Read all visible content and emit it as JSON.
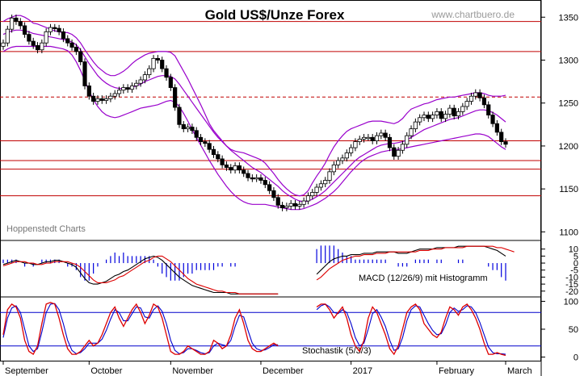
{
  "header": {
    "title": "Gold US$/Unze Forex",
    "watermark": "www.chartbuero.de"
  },
  "chart_data": [
    {
      "type": "candlestick",
      "panel": "price",
      "title": "Gold US$/Unze Forex",
      "source_label": "Hoppenstedt Charts",
      "y_ticks": [
        1100,
        1150,
        1200,
        1250,
        1300,
        1350
      ],
      "ylim": [
        1090,
        1370
      ],
      "x_months": [
        "September",
        "October",
        "November",
        "December",
        "2017",
        "February",
        "March"
      ],
      "horizontal_lines": [
        1345,
        1310,
        1257,
        1206,
        1183,
        1173,
        1142
      ],
      "dashed_lines": [
        1257
      ],
      "closes": [
        1320,
        1336,
        1349,
        1345,
        1340,
        1330,
        1322,
        1317,
        1312,
        1320,
        1333,
        1338,
        1337,
        1333,
        1325,
        1320,
        1315,
        1310,
        1298,
        1270,
        1258,
        1252,
        1255,
        1253,
        1255,
        1258,
        1261,
        1265,
        1268,
        1266,
        1270,
        1273,
        1277,
        1283,
        1290,
        1302,
        1300,
        1290,
        1280,
        1268,
        1245,
        1225,
        1220,
        1222,
        1218,
        1210,
        1205,
        1203,
        1196,
        1190,
        1185,
        1178,
        1175,
        1172,
        1177,
        1172,
        1168,
        1163,
        1162,
        1163,
        1160,
        1155,
        1148,
        1140,
        1131,
        1128,
        1130,
        1133,
        1130,
        1132,
        1136,
        1142,
        1146,
        1152,
        1156,
        1160,
        1170,
        1178,
        1183,
        1186,
        1192,
        1198,
        1205,
        1208,
        1210,
        1210,
        1206,
        1212,
        1215,
        1210,
        1198,
        1188,
        1195,
        1202,
        1212,
        1220,
        1228,
        1233,
        1236,
        1232,
        1236,
        1240,
        1232,
        1237,
        1244,
        1235,
        1240,
        1246,
        1252,
        1258,
        1262,
        1256,
        1248,
        1236,
        1226,
        1216,
        1205,
        1202
      ],
      "bollinger_upper": [
        1345,
        1348,
        1350,
        1352,
        1352,
        1350,
        1347,
        1343,
        1342,
        1340,
        1338,
        1336,
        1334,
        1333,
        1332,
        1332,
        1330,
        1326,
        1320,
        1312,
        1305,
        1298,
        1292,
        1288,
        1284,
        1282,
        1282,
        1284,
        1287,
        1291,
        1296,
        1300,
        1303,
        1306,
        1308,
        1309,
        1310,
        1310,
        1310,
        1309,
        1305,
        1296,
        1287,
        1278,
        1268,
        1258,
        1248,
        1237,
        1226,
        1218,
        1212,
        1206,
        1200,
        1196,
        1194,
        1193,
        1192,
        1190,
        1188,
        1186,
        1184,
        1180,
        1174,
        1168,
        1161,
        1155,
        1150,
        1146,
        1143,
        1142,
        1143,
        1148,
        1157,
        1165,
        1172,
        1180,
        1190,
        1199,
        1206,
        1212,
        1217,
        1220,
        1222,
        1224,
        1226,
        1228,
        1229,
        1229,
        1229,
        1228,
        1227,
        1226,
        1228,
        1232,
        1238,
        1243,
        1245,
        1247,
        1249,
        1250,
        1252,
        1254,
        1255,
        1256,
        1257,
        1257,
        1258,
        1259,
        1260,
        1261,
        1262,
        1262,
        1261,
        1259,
        1258,
        1258,
        1258,
        1259
      ],
      "bollinger_middle": [
        1330,
        1332,
        1334,
        1335,
        1335,
        1334,
        1333,
        1331,
        1330,
        1329,
        1328,
        1327,
        1326,
        1325,
        1324,
        1323,
        1321,
        1318,
        1312,
        1304,
        1296,
        1289,
        1282,
        1277,
        1273,
        1270,
        1268,
        1267,
        1267,
        1267,
        1268,
        1270,
        1272,
        1275,
        1277,
        1279,
        1281,
        1282,
        1282,
        1281,
        1278,
        1272,
        1265,
        1258,
        1251,
        1244,
        1237,
        1230,
        1223,
        1216,
        1210,
        1205,
        1200,
        1195,
        1191,
        1187,
        1183,
        1179,
        1175,
        1172,
        1169,
        1165,
        1161,
        1157,
        1153,
        1148,
        1144,
        1141,
        1138,
        1136,
        1135,
        1136,
        1138,
        1141,
        1144,
        1148,
        1153,
        1158,
        1163,
        1168,
        1173,
        1178,
        1183,
        1187,
        1190,
        1193,
        1196,
        1199,
        1201,
        1202,
        1203,
        1203,
        1204,
        1205,
        1207,
        1210,
        1213,
        1216,
        1219,
        1221,
        1223,
        1225,
        1227,
        1229,
        1231,
        1232,
        1233,
        1235,
        1237,
        1239,
        1241,
        1242,
        1242,
        1241,
        1239,
        1236,
        1232,
        1228
      ],
      "bollinger_lower": [
        1310,
        1313,
        1315,
        1316,
        1316,
        1316,
        1316,
        1316,
        1316,
        1316,
        1316,
        1316,
        1315,
        1314,
        1313,
        1311,
        1306,
        1298,
        1288,
        1276,
        1264,
        1254,
        1246,
        1240,
        1236,
        1234,
        1233,
        1234,
        1236,
        1238,
        1240,
        1242,
        1244,
        1245,
        1246,
        1247,
        1248,
        1250,
        1252,
        1253,
        1251,
        1246,
        1238,
        1229,
        1219,
        1210,
        1201,
        1192,
        1183,
        1175,
        1167,
        1160,
        1153,
        1147,
        1142,
        1138,
        1135,
        1133,
        1132,
        1132,
        1132,
        1132,
        1131,
        1130,
        1129,
        1128,
        1127,
        1126,
        1126,
        1126,
        1127,
        1129,
        1131,
        1133,
        1136,
        1139,
        1143,
        1147,
        1152,
        1158,
        1164,
        1170,
        1175,
        1180,
        1184,
        1187,
        1189,
        1191,
        1193,
        1194,
        1195,
        1196,
        1196,
        1197,
        1198,
        1199,
        1200,
        1201,
        1202,
        1203,
        1204,
        1205,
        1206,
        1207,
        1208,
        1209,
        1210,
        1211,
        1212,
        1213,
        1214,
        1214,
        1213,
        1211,
        1207,
        1203,
        1199,
        1196
      ]
    },
    {
      "type": "line",
      "panel": "macd",
      "label": "MACD (12/26/9) mit Histogramm",
      "y_ticks": [
        10,
        5,
        0,
        -5,
        -10,
        -15,
        -20
      ],
      "ylim": [
        -23,
        15
      ],
      "macd": [
        -1,
        0,
        1,
        2,
        1,
        0,
        0,
        -1,
        -1,
        0,
        1,
        1,
        2,
        2,
        1,
        0,
        -1,
        -3,
        -7,
        -11,
        -14,
        -15,
        -15,
        -14,
        -13,
        -11,
        -9,
        -8,
        -6,
        -5,
        -3,
        -1,
        1,
        3,
        4,
        5,
        4,
        2,
        -1,
        -4,
        -7,
        -10,
        -12,
        -14,
        -16,
        -17,
        -18,
        -19,
        -20,
        -21,
        -21,
        -21,
        -21,
        -22,
        -22,
        -22,
        -22,
        -22,
        -22,
        -22,
        -22,
        -22,
        -22,
        -22,
        -22,
        null,
        null,
        null,
        null,
        null,
        null,
        null,
        null,
        -8,
        -5,
        -2,
        1,
        3,
        4,
        5,
        5,
        6,
        6,
        6,
        7,
        7,
        7,
        8,
        8,
        8,
        8,
        8,
        7,
        7,
        7,
        8,
        9,
        10,
        10,
        10,
        10,
        11,
        11,
        11,
        11,
        11,
        12,
        12,
        12,
        12,
        12,
        12,
        12,
        11,
        10,
        9,
        7,
        5
      ],
      "signal": [
        -2,
        -1,
        0,
        1,
        1,
        1,
        0,
        0,
        -1,
        -1,
        0,
        0,
        1,
        1,
        1,
        1,
        0,
        -1,
        -3,
        -6,
        -9,
        -12,
        -14,
        -14,
        -14,
        -13,
        -12,
        -10,
        -9,
        -7,
        -5,
        -3,
        -1,
        1,
        2,
        4,
        5,
        5,
        3,
        1,
        -2,
        -5,
        -8,
        -11,
        -13,
        -15,
        -16,
        -17,
        -18,
        -19,
        -20,
        -20,
        -21,
        -21,
        -21,
        -22,
        -22,
        -22,
        -22,
        -22,
        -22,
        -22,
        -22,
        -22,
        -22,
        null,
        null,
        null,
        null,
        null,
        null,
        null,
        null,
        -12,
        -10,
        -7,
        -4,
        -2,
        0,
        2,
        3,
        4,
        5,
        5,
        6,
        6,
        6,
        7,
        7,
        7,
        8,
        8,
        8,
        8,
        8,
        8,
        8,
        9,
        9,
        9,
        10,
        10,
        10,
        11,
        11,
        11,
        11,
        11,
        12,
        12,
        12,
        12,
        12,
        12,
        12,
        11,
        11,
        10,
        9,
        8
      ]
    },
    {
      "type": "line",
      "panel": "stochastic",
      "label": "Stochastik (5/3/3)",
      "y_ticks": [
        100,
        50,
        0
      ],
      "ylim": [
        -5,
        105
      ],
      "reference_lines": [
        80,
        20
      ],
      "k": [
        40,
        85,
        95,
        90,
        70,
        30,
        10,
        5,
        20,
        60,
        95,
        98,
        95,
        70,
        40,
        15,
        5,
        5,
        10,
        20,
        30,
        20,
        25,
        40,
        60,
        80,
        90,
        70,
        55,
        70,
        85,
        95,
        80,
        60,
        75,
        95,
        90,
        70,
        40,
        10,
        5,
        5,
        10,
        20,
        15,
        10,
        5,
        5,
        10,
        30,
        25,
        15,
        20,
        40,
        70,
        85,
        60,
        30,
        15,
        10,
        10,
        15,
        20,
        25,
        20,
        null,
        null,
        null,
        null,
        null,
        null,
        null,
        null,
        90,
        95,
        95,
        85,
        70,
        80,
        90,
        70,
        40,
        20,
        10,
        30,
        70,
        90,
        80,
        60,
        40,
        15,
        5,
        20,
        50,
        80,
        90,
        95,
        85,
        60,
        50,
        40,
        35,
        45,
        70,
        90,
        85,
        75,
        90,
        95,
        85,
        70,
        50,
        25,
        5,
        5,
        8,
        5,
        3
      ],
      "d": [
        35,
        70,
        88,
        92,
        80,
        50,
        20,
        10,
        15,
        45,
        80,
        95,
        96,
        85,
        60,
        30,
        12,
        6,
        8,
        15,
        25,
        25,
        25,
        32,
        48,
        68,
        85,
        80,
        65,
        65,
        78,
        90,
        88,
        72,
        70,
        85,
        92,
        82,
        60,
        30,
        12,
        6,
        8,
        15,
        15,
        12,
        8,
        6,
        8,
        20,
        25,
        22,
        20,
        30,
        55,
        75,
        72,
        48,
        25,
        15,
        12,
        13,
        17,
        22,
        22,
        null,
        null,
        null,
        null,
        null,
        null,
        null,
        null,
        85,
        92,
        95,
        90,
        80,
        78,
        85,
        80,
        60,
        35,
        20,
        25,
        50,
        78,
        85,
        72,
        55,
        30,
        12,
        15,
        35,
        65,
        85,
        92,
        90,
        75,
        60,
        48,
        40,
        42,
        58,
        80,
        88,
        82,
        85,
        92,
        90,
        80,
        62,
        40,
        18,
        8,
        6,
        6,
        5
      ]
    }
  ]
}
